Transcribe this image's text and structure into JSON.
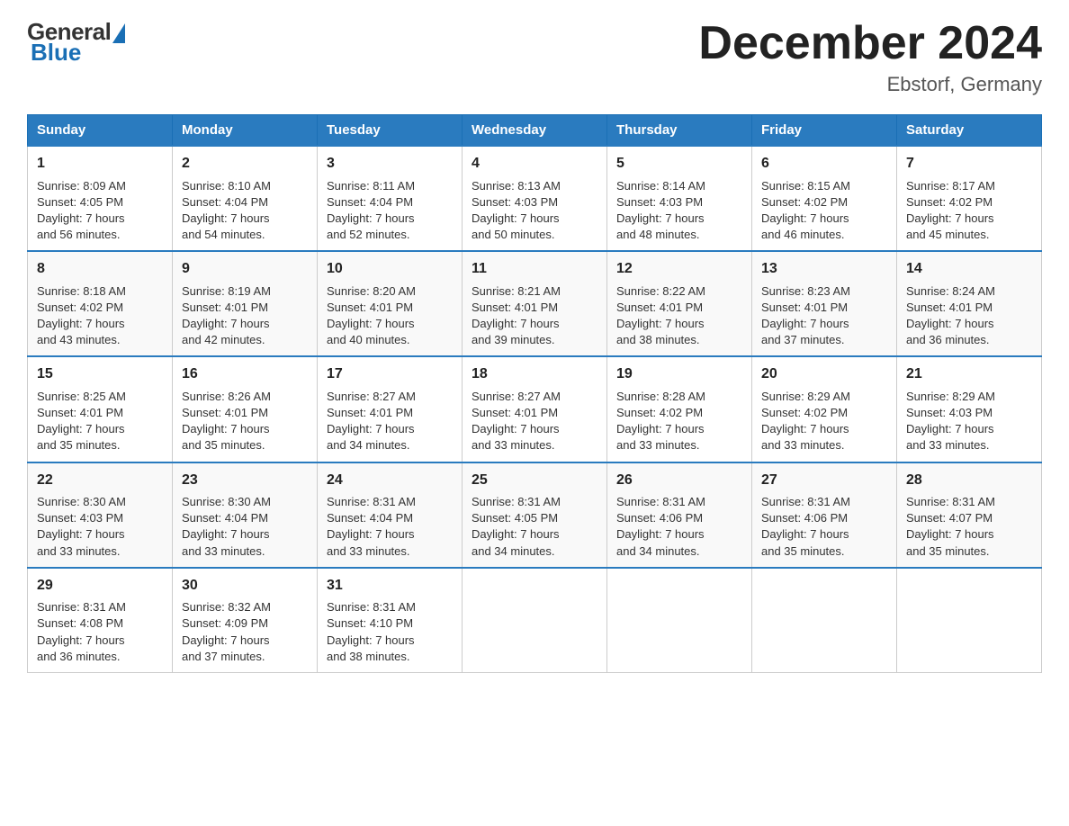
{
  "logo": {
    "general": "General",
    "blue": "Blue"
  },
  "header": {
    "title": "December 2024",
    "subtitle": "Ebstorf, Germany"
  },
  "weekdays": [
    "Sunday",
    "Monday",
    "Tuesday",
    "Wednesday",
    "Thursday",
    "Friday",
    "Saturday"
  ],
  "weeks": [
    [
      {
        "day": "1",
        "sunrise": "8:09 AM",
        "sunset": "4:05 PM",
        "daylight": "7 hours and 56 minutes."
      },
      {
        "day": "2",
        "sunrise": "8:10 AM",
        "sunset": "4:04 PM",
        "daylight": "7 hours and 54 minutes."
      },
      {
        "day": "3",
        "sunrise": "8:11 AM",
        "sunset": "4:04 PM",
        "daylight": "7 hours and 52 minutes."
      },
      {
        "day": "4",
        "sunrise": "8:13 AM",
        "sunset": "4:03 PM",
        "daylight": "7 hours and 50 minutes."
      },
      {
        "day": "5",
        "sunrise": "8:14 AM",
        "sunset": "4:03 PM",
        "daylight": "7 hours and 48 minutes."
      },
      {
        "day": "6",
        "sunrise": "8:15 AM",
        "sunset": "4:02 PM",
        "daylight": "7 hours and 46 minutes."
      },
      {
        "day": "7",
        "sunrise": "8:17 AM",
        "sunset": "4:02 PM",
        "daylight": "7 hours and 45 minutes."
      }
    ],
    [
      {
        "day": "8",
        "sunrise": "8:18 AM",
        "sunset": "4:02 PM",
        "daylight": "7 hours and 43 minutes."
      },
      {
        "day": "9",
        "sunrise": "8:19 AM",
        "sunset": "4:01 PM",
        "daylight": "7 hours and 42 minutes."
      },
      {
        "day": "10",
        "sunrise": "8:20 AM",
        "sunset": "4:01 PM",
        "daylight": "7 hours and 40 minutes."
      },
      {
        "day": "11",
        "sunrise": "8:21 AM",
        "sunset": "4:01 PM",
        "daylight": "7 hours and 39 minutes."
      },
      {
        "day": "12",
        "sunrise": "8:22 AM",
        "sunset": "4:01 PM",
        "daylight": "7 hours and 38 minutes."
      },
      {
        "day": "13",
        "sunrise": "8:23 AM",
        "sunset": "4:01 PM",
        "daylight": "7 hours and 37 minutes."
      },
      {
        "day": "14",
        "sunrise": "8:24 AM",
        "sunset": "4:01 PM",
        "daylight": "7 hours and 36 minutes."
      }
    ],
    [
      {
        "day": "15",
        "sunrise": "8:25 AM",
        "sunset": "4:01 PM",
        "daylight": "7 hours and 35 minutes."
      },
      {
        "day": "16",
        "sunrise": "8:26 AM",
        "sunset": "4:01 PM",
        "daylight": "7 hours and 35 minutes."
      },
      {
        "day": "17",
        "sunrise": "8:27 AM",
        "sunset": "4:01 PM",
        "daylight": "7 hours and 34 minutes."
      },
      {
        "day": "18",
        "sunrise": "8:27 AM",
        "sunset": "4:01 PM",
        "daylight": "7 hours and 33 minutes."
      },
      {
        "day": "19",
        "sunrise": "8:28 AM",
        "sunset": "4:02 PM",
        "daylight": "7 hours and 33 minutes."
      },
      {
        "day": "20",
        "sunrise": "8:29 AM",
        "sunset": "4:02 PM",
        "daylight": "7 hours and 33 minutes."
      },
      {
        "day": "21",
        "sunrise": "8:29 AM",
        "sunset": "4:03 PM",
        "daylight": "7 hours and 33 minutes."
      }
    ],
    [
      {
        "day": "22",
        "sunrise": "8:30 AM",
        "sunset": "4:03 PM",
        "daylight": "7 hours and 33 minutes."
      },
      {
        "day": "23",
        "sunrise": "8:30 AM",
        "sunset": "4:04 PM",
        "daylight": "7 hours and 33 minutes."
      },
      {
        "day": "24",
        "sunrise": "8:31 AM",
        "sunset": "4:04 PM",
        "daylight": "7 hours and 33 minutes."
      },
      {
        "day": "25",
        "sunrise": "8:31 AM",
        "sunset": "4:05 PM",
        "daylight": "7 hours and 34 minutes."
      },
      {
        "day": "26",
        "sunrise": "8:31 AM",
        "sunset": "4:06 PM",
        "daylight": "7 hours and 34 minutes."
      },
      {
        "day": "27",
        "sunrise": "8:31 AM",
        "sunset": "4:06 PM",
        "daylight": "7 hours and 35 minutes."
      },
      {
        "day": "28",
        "sunrise": "8:31 AM",
        "sunset": "4:07 PM",
        "daylight": "7 hours and 35 minutes."
      }
    ],
    [
      {
        "day": "29",
        "sunrise": "8:31 AM",
        "sunset": "4:08 PM",
        "daylight": "7 hours and 36 minutes."
      },
      {
        "day": "30",
        "sunrise": "8:32 AM",
        "sunset": "4:09 PM",
        "daylight": "7 hours and 37 minutes."
      },
      {
        "day": "31",
        "sunrise": "8:31 AM",
        "sunset": "4:10 PM",
        "daylight": "7 hours and 38 minutes."
      },
      null,
      null,
      null,
      null
    ]
  ],
  "labels": {
    "sunrise": "Sunrise:",
    "sunset": "Sunset:",
    "daylight": "Daylight:"
  }
}
